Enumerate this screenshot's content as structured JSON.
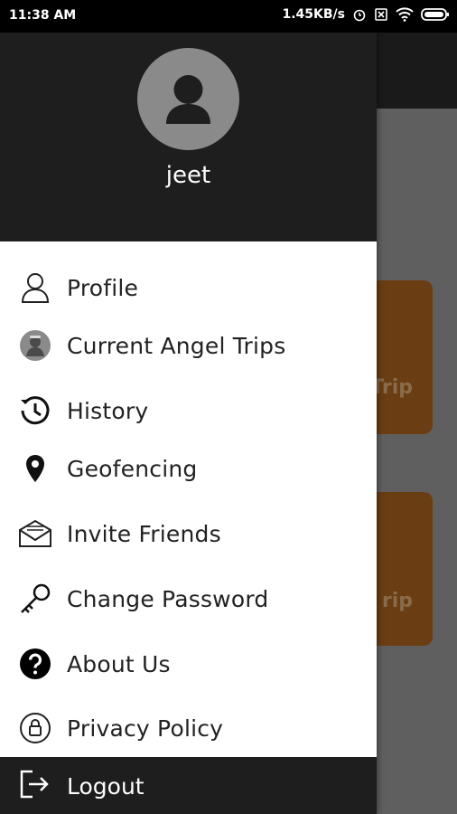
{
  "status_bar": {
    "time": "11:38 AM",
    "speed": "1.45KB/s",
    "icons": [
      "alarm-icon",
      "sim-off-icon",
      "wifi-icon",
      "battery-icon"
    ]
  },
  "background": {
    "card_1_label": "Trip",
    "card_2_label": "rip",
    "accent_color": "#6a3d12"
  },
  "drawer": {
    "user_name": "jeet",
    "avatar_icon": "person-icon",
    "menu": [
      {
        "label": "Profile",
        "icon": "person-outline-icon"
      },
      {
        "label": "Current Angel Trips",
        "icon": "angel-avatar-icon"
      },
      {
        "label": "History",
        "icon": "history-icon"
      },
      {
        "label": "Geofencing",
        "icon": "location-pin-icon"
      },
      {
        "label": "Invite Friends",
        "icon": "envelope-icon"
      },
      {
        "label": "Change Password",
        "icon": "key-icon"
      },
      {
        "label": "About Us",
        "icon": "help-icon"
      },
      {
        "label": "Privacy Policy",
        "icon": "lock-icon"
      }
    ],
    "logout": {
      "label": "Logout",
      "icon": "logout-icon"
    }
  }
}
